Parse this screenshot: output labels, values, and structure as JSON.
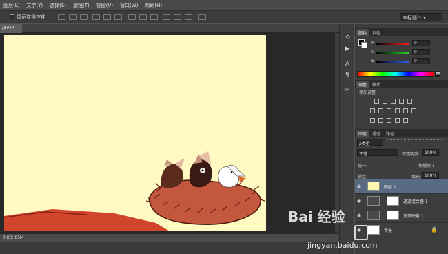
{
  "menu": [
    "图层(L)",
    "文字(Y)",
    "选择(S)",
    "滤镜(T)",
    "视图(V)",
    "窗口(W)",
    "帮助(H)"
  ],
  "options": {
    "show_transform": "显示变换控件"
  },
  "workspace": "未标题-1",
  "document": {
    "tab": "/8#) *",
    "status": "0 K/2.85M"
  },
  "color_panel": {
    "tabs": [
      "颜色",
      "色板"
    ],
    "channels": [
      {
        "label": "R",
        "value": "0",
        "color": "#d02020"
      },
      {
        "label": "G",
        "value": "0",
        "color": "#20a020"
      },
      {
        "label": "B",
        "value": "0",
        "color": "#2040d0"
      }
    ]
  },
  "adjust_panel": {
    "tabs": [
      "调整",
      "样式"
    ],
    "title": "添加调整"
  },
  "layers_panel": {
    "tabs": [
      "图层",
      "通道",
      "路径"
    ],
    "filter": "ρ类型",
    "blend_mode": "正常",
    "opacity_label": "不透明度:",
    "opacity": "100%",
    "unify_label": "统一:",
    "propagate_label": "传播帧 1",
    "lock_label": "锁定:",
    "fill_label": "填充:",
    "fill": "100%",
    "layers": [
      {
        "name": "图层 1",
        "selected": true,
        "thumb": "#fff6b0"
      },
      {
        "name": "通道混合器 1",
        "selected": false,
        "thumb": "#ffffff"
      },
      {
        "name": "渐变映射 1",
        "selected": false,
        "thumb": "#ffffff"
      },
      {
        "name": "背景",
        "selected": false,
        "thumb": "#ffffff"
      }
    ]
  },
  "watermark": {
    "text": "Bai  经验",
    "url": "jingyan.baidu.com"
  },
  "colors": {
    "canvas": "#fff9c2",
    "workspace_bg": "#282828",
    "selection": "#596b82"
  }
}
